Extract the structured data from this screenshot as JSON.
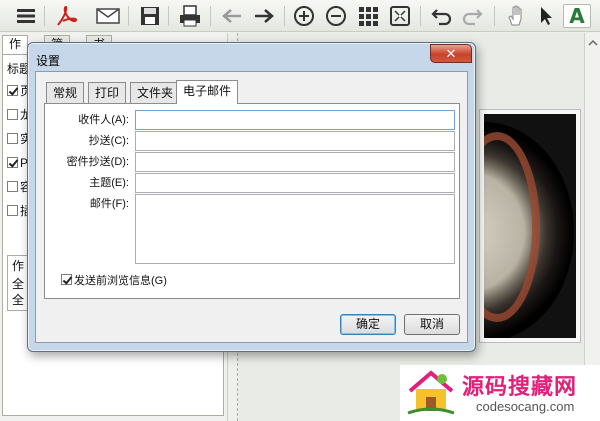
{
  "toolbar": {
    "icons": [
      "menu-icon",
      "pdf-icon",
      "mail-icon",
      "save-icon",
      "print-icon",
      "back-icon",
      "forward-icon",
      "zoom-in-icon",
      "zoom-out-icon",
      "grid-icon",
      "fit-icon",
      "undo-icon",
      "redo-icon",
      "hand-icon",
      "pointer-icon",
      "text-icon"
    ],
    "text_tool": "A",
    "accent": "#2a7a3a"
  },
  "left_panel": {
    "tabs": [
      "作业",
      "筛签",
      "书签"
    ],
    "partial_label": "标题",
    "rows": [
      {
        "char": "页",
        "checked": true
      },
      {
        "char": "龙",
        "checked": false
      },
      {
        "char": "实",
        "checked": false
      },
      {
        "char": "P",
        "checked": true
      },
      {
        "char": "容",
        "checked": false
      },
      {
        "char": "插",
        "checked": false
      }
    ],
    "group_label": "作",
    "group_items": [
      "全",
      "全"
    ]
  },
  "dialog": {
    "title": "设置",
    "close": "✕",
    "tabs": [
      "常规",
      "打印",
      "文件夹",
      "电子邮件"
    ],
    "active_tab": 3,
    "fields": {
      "to": "收件人(A):",
      "cc": "抄送(C):",
      "bcc": "密件抄送(D):",
      "subject": "主题(E):",
      "body": "邮件(F):"
    },
    "preview_checkbox": "发送前浏览信息(G)",
    "preview_checked": true,
    "ok": "确定",
    "cancel": "取消"
  },
  "watermark": {
    "title": "源码搜藏网",
    "url": "codesocang.com"
  }
}
